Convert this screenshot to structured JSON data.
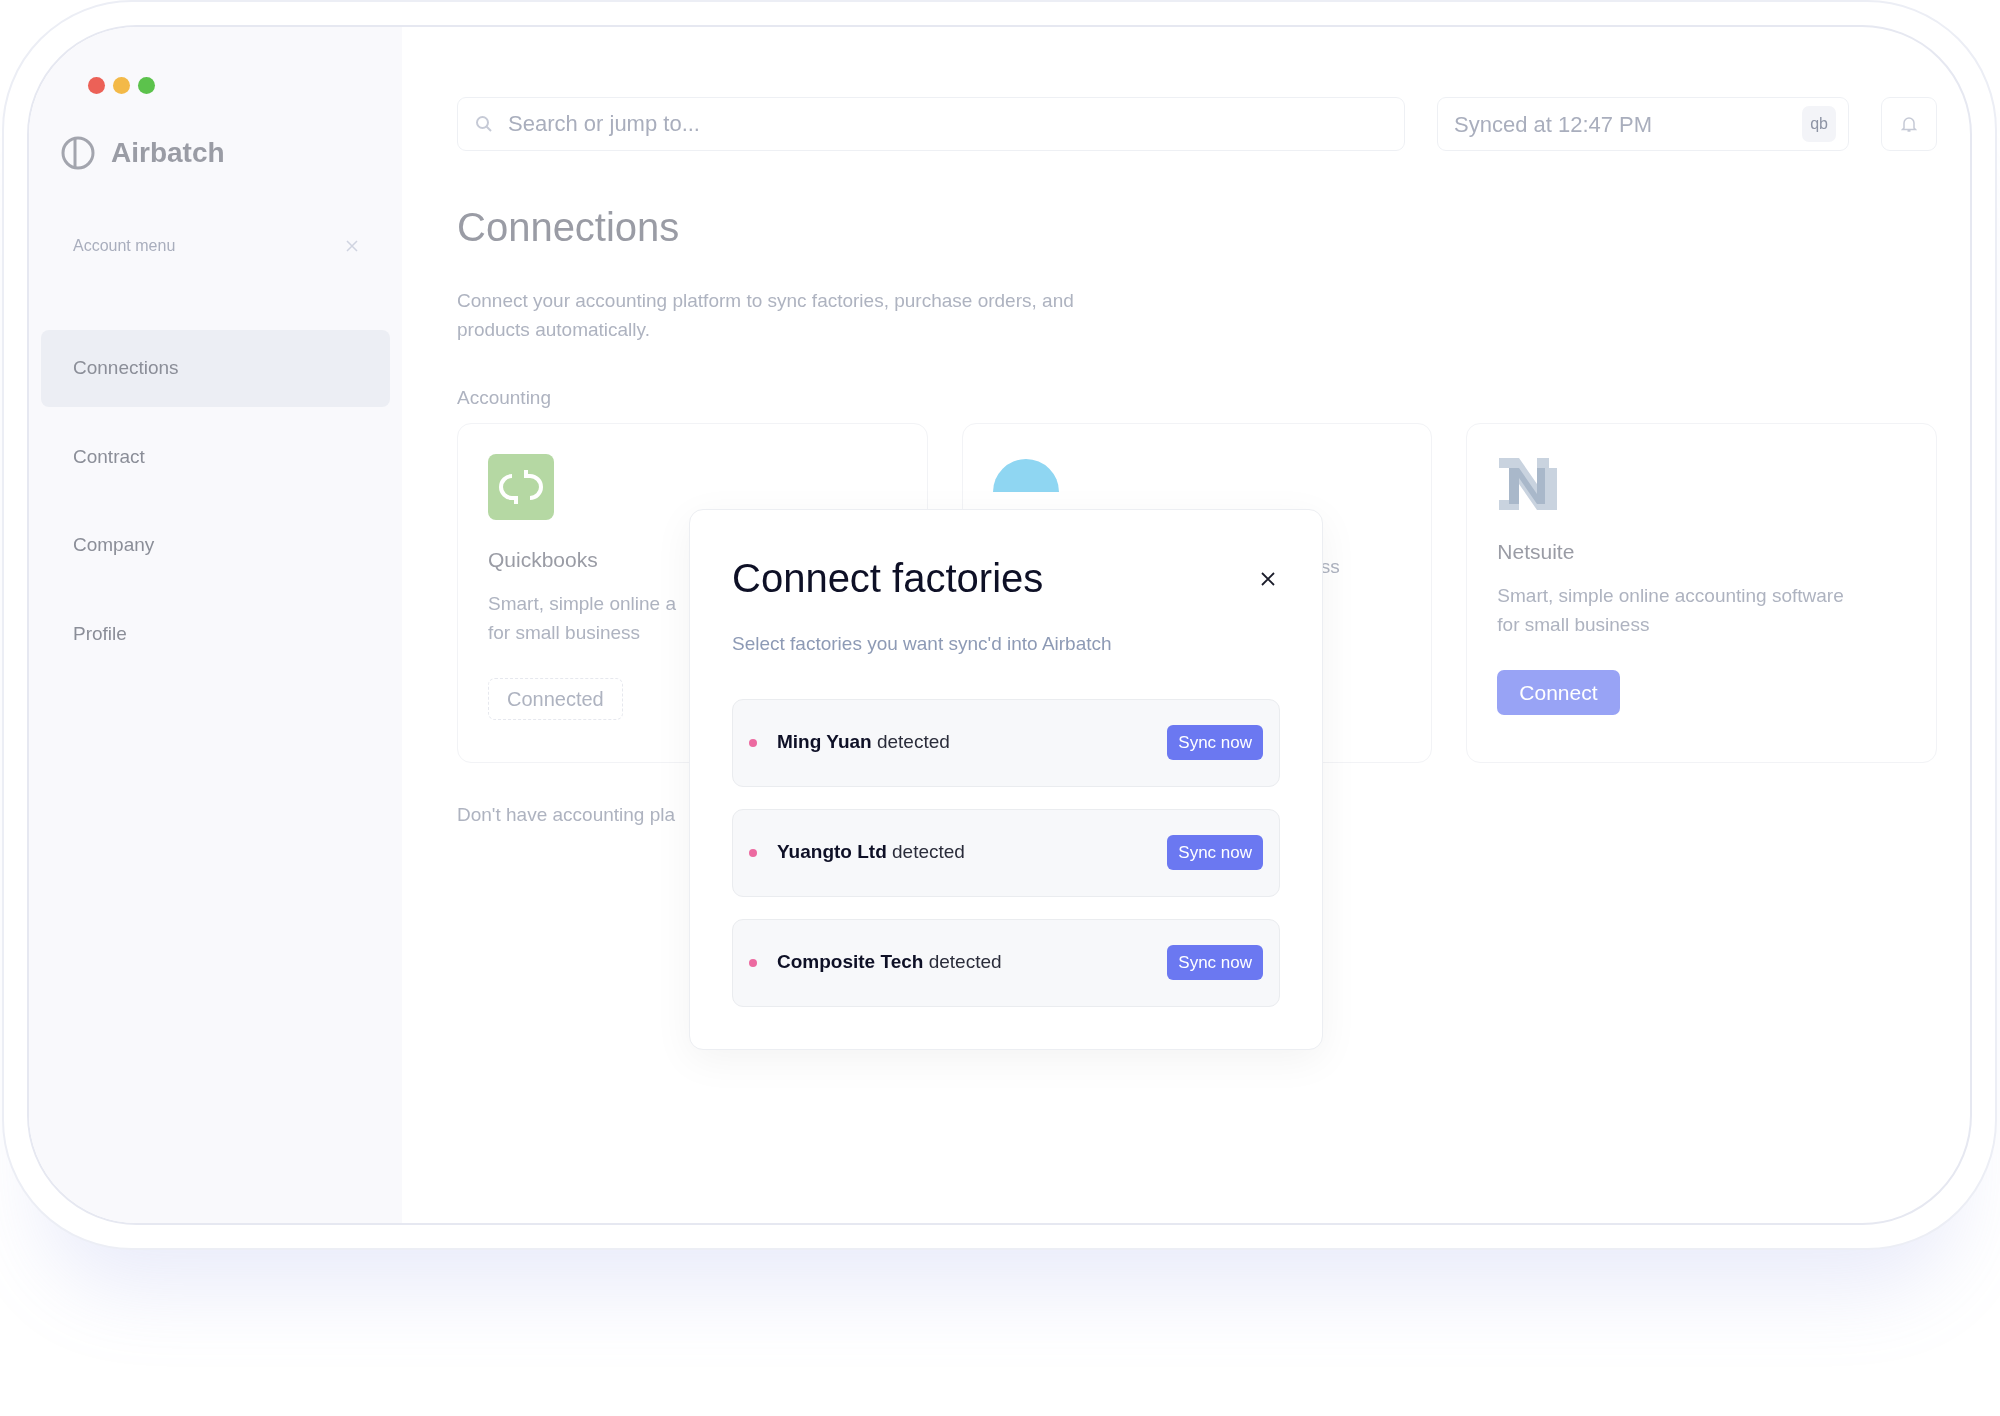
{
  "window_controls": [
    {
      "color": "#ec6157"
    },
    {
      "color": "#f3b948"
    },
    {
      "color": "#5cc24c"
    }
  ],
  "app": {
    "name": "Airbatch"
  },
  "sidebar": {
    "account_menu": "Account menu",
    "items": [
      {
        "label": "Connections",
        "selected": true
      },
      {
        "label": "Contract",
        "selected": false
      },
      {
        "label": "Company",
        "selected": false
      },
      {
        "label": "Profile",
        "selected": false
      }
    ]
  },
  "header": {
    "search": {
      "placeholder": "Search or jump to..."
    },
    "sync_status": "Synced at 12:47 PM",
    "sync_badge": "qb"
  },
  "page": {
    "title": "Connections",
    "description": "Connect your accounting platform to sync factories, purchase orders, and products automatically.",
    "section": "Accounting",
    "cards": [
      {
        "kind": "quickbooks",
        "name": "Quickbooks",
        "description_lines": [
          "Smart, simple online a",
          "for small business"
        ],
        "button": {
          "label": "Connected",
          "connected": true
        }
      },
      {
        "kind": "xero",
        "description_lines": [
          "ss"
        ]
      },
      {
        "kind": "netsuite",
        "name": "Netsuite",
        "description_lines": [
          "Smart, simple online accounting software",
          "for small business"
        ],
        "button": {
          "label": "Connect",
          "connected": false
        }
      }
    ],
    "footer_note": "Don't have accounting pla"
  },
  "modal": {
    "title": "Connect factories",
    "subtitle": "Select factories you want sync'd into Airbatch",
    "factories": [
      {
        "name": "Ming Yuan",
        "status": "detected",
        "button": "Sync now"
      },
      {
        "name": "Yuangto Ltd",
        "status": "detected",
        "button": "Sync now"
      },
      {
        "name": "Composite Tech",
        "status": "detected",
        "button": "Sync now"
      }
    ]
  }
}
